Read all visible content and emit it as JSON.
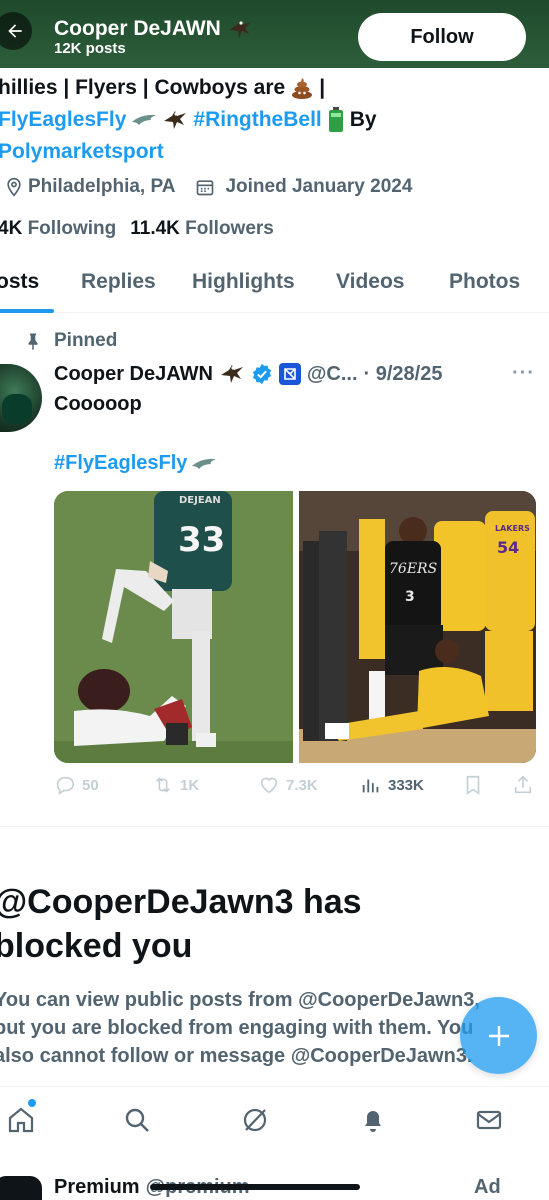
{
  "header": {
    "name": "Cooper DeJAWN",
    "posts_count": "12K posts",
    "follow_label": "Follow"
  },
  "bio": {
    "line1_text": "hillies | Flyers | Cowboys are",
    "line2_tag1": "FlyEaglesFly",
    "line2_tag2": "#RingtheBell",
    "line2_by": "By",
    "line3_mention": "Polymarketsport"
  },
  "meta": {
    "location": "Philadelphia, PA",
    "joined": "Joined January 2024"
  },
  "stats": {
    "following_num": "4K",
    "following_label": "Following",
    "followers_num": "11.4K",
    "followers_label": "Followers"
  },
  "tabs": [
    {
      "label": "osts"
    },
    {
      "label": "Replies"
    },
    {
      "label": "Highlights"
    },
    {
      "label": "Videos"
    },
    {
      "label": "Photos"
    }
  ],
  "post": {
    "pinned_label": "Pinned",
    "author_name": "Cooper DeJAWN",
    "handle": "@C...",
    "date": "· 9/28/25",
    "text": "Cooooop",
    "hashtag": "#FlyEaglesFly",
    "image_left": {
      "jersey_name": "DEJEAN",
      "jersey_number": "33"
    },
    "image_right": {
      "jersey_team": "76ERS",
      "jersey_number": "3",
      "other_number": "54",
      "other_team": "LAKERS"
    },
    "actions": {
      "replies": "50",
      "reposts": "1K",
      "likes": "7.3K",
      "views": "333K"
    }
  },
  "blocked": {
    "title": "@CooperDeJawn3 has blocked you",
    "body": "You can view public posts from @CooperDeJawn3, but you are blocked from engaging with them. You also cannot follow or message @CooperDeJawn3."
  },
  "ad": {
    "name": "Premium",
    "handle": "@premium",
    "label": "Ad"
  },
  "icons": {
    "back": "back-arrow-icon",
    "bird": "eagle-emoji-icon",
    "location": "location-pin-icon",
    "calendar": "calendar-icon",
    "pin": "pin-icon",
    "verified": "verified-badge-icon",
    "reply": "reply-icon",
    "repost": "repost-icon",
    "like": "heart-icon",
    "views": "views-icon",
    "bookmark": "bookmark-icon",
    "share": "share-icon",
    "compose": "plus-icon",
    "home": "home-icon",
    "search": "search-icon",
    "grok": "grok-icon",
    "notifications": "bell-icon",
    "messages": "mail-icon"
  },
  "colors": {
    "accent": "#1d9bf0",
    "header_bg": "#2d5e3a",
    "muted": "#536471"
  }
}
